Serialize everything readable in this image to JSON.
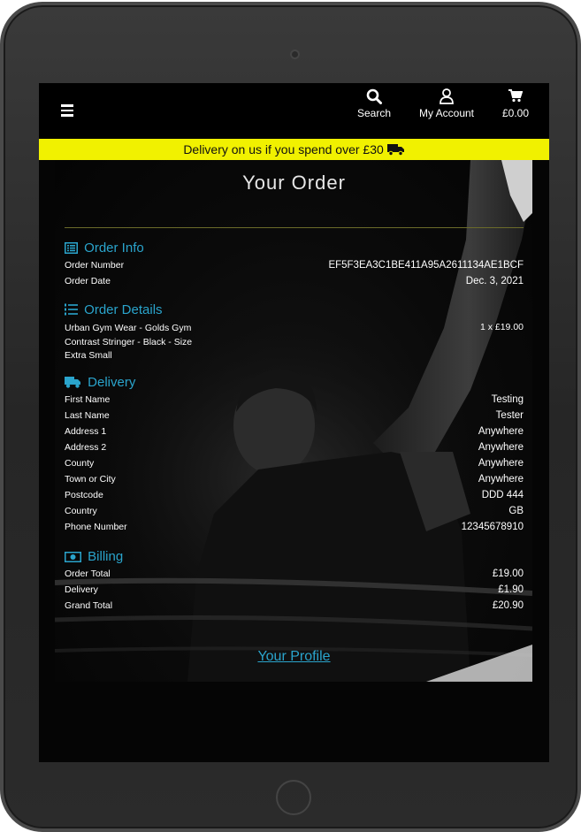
{
  "nav": {
    "search_label": "Search",
    "account_label": "My Account",
    "cart_label": "£0.00"
  },
  "banner": {
    "text": "Delivery on us if you spend over £30"
  },
  "page_title": "Your Order",
  "order_info": {
    "heading": "Order Info",
    "rows": [
      {
        "label": "Order Number",
        "value": "EF5F3EA3C1BE411A95A2611134AE1BCF"
      },
      {
        "label": "Order Date",
        "value": "Dec. 3, 2021"
      }
    ]
  },
  "order_details": {
    "heading": "Order Details",
    "item_name": "Urban Gym Wear - Golds Gym Contrast Stringer - Black - Size Extra Small",
    "item_qty": "1 x £19.00"
  },
  "delivery": {
    "heading": "Delivery",
    "rows": [
      {
        "label": "First Name",
        "value": "Testing"
      },
      {
        "label": "Last Name",
        "value": "Tester"
      },
      {
        "label": "Address 1",
        "value": "Anywhere"
      },
      {
        "label": "Address 2",
        "value": "Anywhere"
      },
      {
        "label": "County",
        "value": "Anywhere"
      },
      {
        "label": "Town or City",
        "value": "Anywhere"
      },
      {
        "label": "Postcode",
        "value": "DDD 444"
      },
      {
        "label": "Country",
        "value": "GB"
      },
      {
        "label": "Phone Number",
        "value": "12345678910"
      }
    ]
  },
  "billing": {
    "heading": "Billing",
    "rows": [
      {
        "label": "Order Total",
        "value": "£19.00"
      },
      {
        "label": "Delivery",
        "value": "£1.90"
      },
      {
        "label": "Grand Total",
        "value": "£20.90"
      }
    ]
  },
  "profile_link": "Your Profile",
  "colors": {
    "accent": "#2aa4cc",
    "banner": "#f1f100",
    "background": "#050505"
  }
}
